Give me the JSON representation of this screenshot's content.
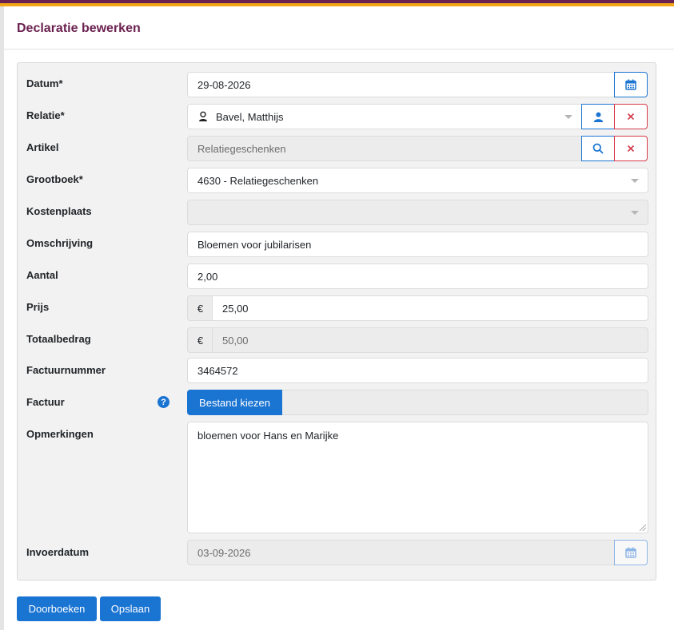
{
  "title": "Declaratie bewerken",
  "fields": {
    "datum": {
      "label": "Datum*",
      "value": "29-08-2026"
    },
    "relatie": {
      "label": "Relatie*",
      "value": "Bavel, Matthijs"
    },
    "artikel": {
      "label": "Artikel",
      "value": "Relatiegeschenken"
    },
    "grootboek": {
      "label": "Grootboek*",
      "value": "4630 - Relatiegeschenken"
    },
    "kostenplaats": {
      "label": "Kostenplaats",
      "value": ""
    },
    "omschrijving": {
      "label": "Omschrijving",
      "value": "Bloemen voor jubilarisen"
    },
    "aantal": {
      "label": "Aantal",
      "value": "2,00"
    },
    "prijs": {
      "label": "Prijs",
      "currency": "€",
      "value": "25,00"
    },
    "totaalbedrag": {
      "label": "Totaalbedrag",
      "currency": "€",
      "value": "50,00"
    },
    "factuurnummer": {
      "label": "Factuurnummer",
      "value": "3464572"
    },
    "factuur": {
      "label": "Factuur",
      "button": "Bestand kiezen",
      "help": "?"
    },
    "opmerkingen": {
      "label": "Opmerkingen",
      "value": "bloemen voor Hans en Marijke"
    },
    "invoerdatum": {
      "label": "Invoerdatum",
      "value": "03-09-2026"
    }
  },
  "actions": {
    "doorboeken": "Doorboeken",
    "opslaan": "Opslaan"
  },
  "icons": {
    "calendar": "calendar-icon",
    "user": "user-icon",
    "close": "close-icon",
    "search": "search-icon",
    "person_badge": "person-icon"
  },
  "colors": {
    "brand": "#6b2150",
    "accent": "#f0a616",
    "primary": "#1a74d2",
    "danger": "#d63a4a"
  }
}
